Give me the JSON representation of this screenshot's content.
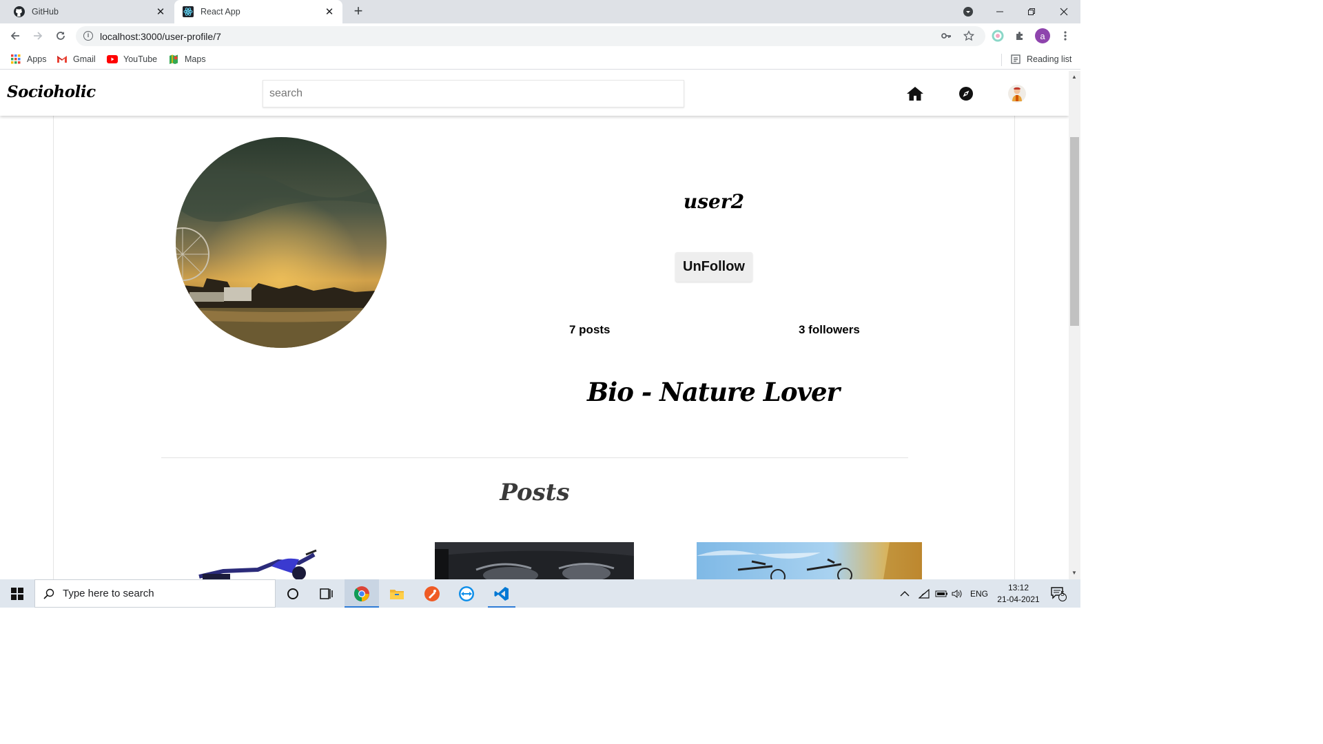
{
  "browser": {
    "tabs": [
      {
        "title": "GitHub",
        "active": false,
        "icon": "github-icon"
      },
      {
        "title": "React App",
        "active": true,
        "icon": "react-icon"
      }
    ],
    "url": "localhost:3000/user-profile/7",
    "bookmarks": [
      {
        "label": "Apps",
        "icon": "apps-grid-icon"
      },
      {
        "label": "Gmail",
        "icon": "gmail-icon"
      },
      {
        "label": "YouTube",
        "icon": "youtube-icon"
      },
      {
        "label": "Maps",
        "icon": "maps-icon"
      }
    ],
    "reading_list": "Reading list",
    "profile_initial": "a"
  },
  "app": {
    "brand": "Socioholic",
    "search_placeholder": "search",
    "colors": {
      "text": "#000000",
      "button_bg": "#eeeeee",
      "navbar_bg": "#ffffff"
    }
  },
  "profile": {
    "username": "user2",
    "follow_button": "UnFollow",
    "posts_count": "7 posts",
    "followers_count": "3 followers",
    "bio": "Bio - Nature Lover",
    "posts_heading": "Posts"
  },
  "taskbar": {
    "search_placeholder": "Type here to search",
    "language": "ENG",
    "time": "13:12",
    "date": "21-04-2021",
    "notifications": "5"
  }
}
